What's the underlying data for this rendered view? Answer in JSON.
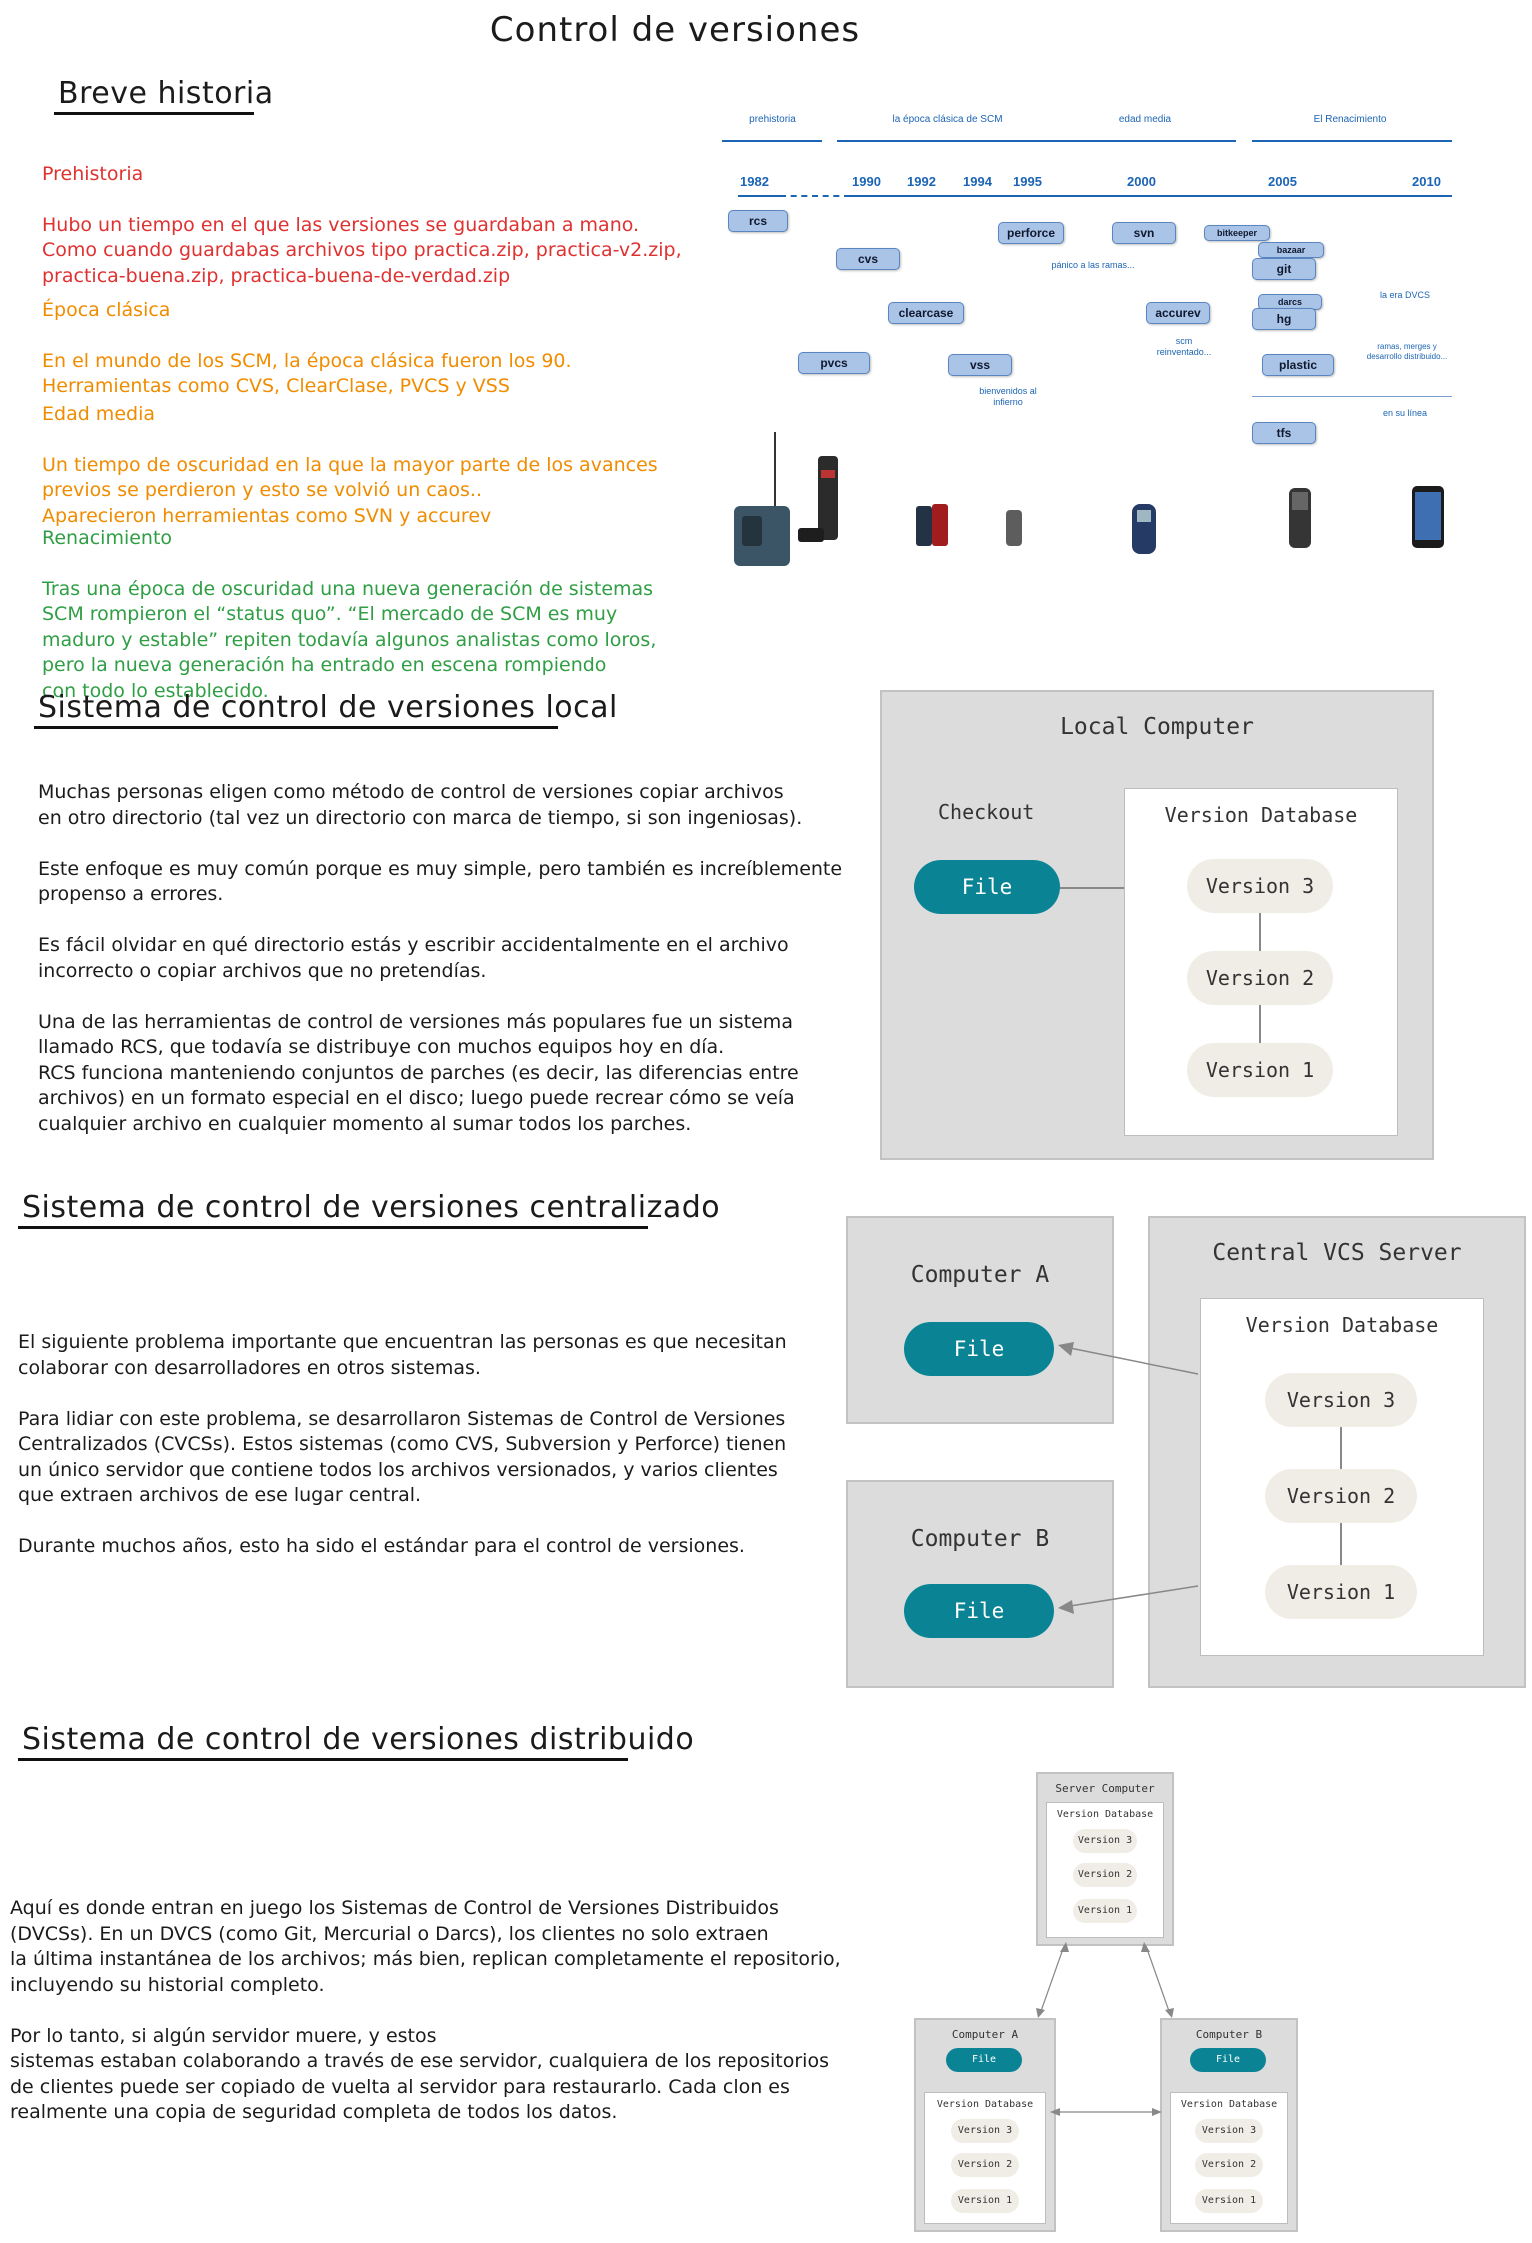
{
  "page_title": "Control de versiones",
  "history": {
    "heading": "Breve historia",
    "prehistoria": {
      "title": "Prehistoria",
      "text": "Hubo un tiempo en el que las versiones se guardaban a mano.\nComo cuando guardabas archivos tipo practica.zip, practica-v2.zip,\npractica-buena.zip, practica-buena-de-verdad.zip"
    },
    "clasica": {
      "title": "Época clásica",
      "text": "En el mundo de los SCM, la época clásica fueron los 90.\nHerramientas como CVS, ClearClase, PVCS y VSS"
    },
    "media": {
      "title": "Edad media",
      "text": "Un tiempo de oscuridad en la que la mayor parte de los avances\nprevios se perdieron y esto se volvió un caos..\nAparecieron herramientas como SVN y accurev"
    },
    "renacimiento": {
      "title": "Renacimiento",
      "text": "Tras una época de oscuridad una nueva generación de sistemas\nSCM rompieron el “status quo”. “El mercado de SCM es muy\nmaduro y estable” repiten todavía algunos analistas como loros,\npero la nueva generación ha entrado en escena rompiendo\ncon todo lo establecido."
    }
  },
  "timeline": {
    "eras": [
      "prehistoria",
      "la época clásica de SCM",
      "edad media",
      "El Renacimiento"
    ],
    "years": [
      "1982",
      "1990",
      "1992",
      "1994",
      "1995",
      "2000",
      "2005",
      "2010"
    ],
    "tools": [
      "rcs",
      "cvs",
      "clearcase",
      "pvcs",
      "vss",
      "perforce",
      "svn",
      "accurev",
      "bitkeeper",
      "bazaar",
      "git",
      "darcs",
      "hg",
      "plastic",
      "tfs"
    ],
    "notes": {
      "panico": "pánico a las ramas...",
      "bienvenidos": "bienvenidos al\ninfierno",
      "scm": "scm\nreinventado...",
      "dvcs": "la era DVCS",
      "ramas": "ramas, merges y\ndesarrollo distribuido...",
      "linea": "en su línea"
    }
  },
  "local": {
    "heading": "Sistema de control de versiones local",
    "text": "Muchas personas eligen como método de control de versiones copiar archivos\nen otro directorio (tal vez un directorio con marca de tiempo, si son ingeniosas).\n\nEste enfoque es muy común porque es muy simple, pero también es increíblemente\npropenso a errores.\n\nEs fácil olvidar en qué directorio estás y escribir accidentalmente en el archivo\nincorrecto o copiar archivos que no pretendías.\n\nUna de las herramientas de control de versiones más populares fue un sistema\nllamado RCS, que todavía se distribuye con muchos equipos hoy en día.\nRCS funciona manteniendo conjuntos de parches (es decir, las diferencias entre\narchivos) en un formato especial en el disco; luego puede recrear cómo se veía\ncualquier archivo en cualquier momento al sumar todos los parches.",
    "diagram": {
      "title": "Local Computer",
      "checkout": "Checkout",
      "file": "File",
      "db": "Version Database",
      "versions": [
        "Version 3",
        "Version 2",
        "Version 1"
      ]
    }
  },
  "central": {
    "heading": "Sistema de control de versiones centralizado",
    "text": "El siguiente problema importante que encuentran las personas es que necesitan\ncolaborar con desarrolladores en otros sistemas.\n\nPara lidiar con este problema, se desarrollaron Sistemas de Control de Versiones\nCentralizados (CVCSs). Estos sistemas (como CVS, Subversion y Perforce) tienen\nun único servidor que contiene todos los archivos versionados, y varios clientes\nque extraen archivos de ese lugar central.\n\nDurante muchos años, esto ha sido el estándar para el control de versiones.",
    "diagram": {
      "computer_a": "Computer A",
      "computer_b": "Computer B",
      "file": "File",
      "server": "Central VCS Server",
      "db": "Version Database",
      "versions": [
        "Version 3",
        "Version 2",
        "Version 1"
      ]
    }
  },
  "distributed": {
    "heading": "Sistema de control de versiones distribuido",
    "text": "Aquí es donde entran en juego los Sistemas de Control de Versiones Distribuidos\n(DVCSs). En un DVCS (como Git, Mercurial o Darcs), los clientes no solo extraen\nla última instantánea de los archivos; más bien, replican completamente el repositorio,\nincluyendo su historial completo.\n\nPor lo tanto, si algún servidor muere, y estos\nsistemas estaban colaborando a través de ese servidor, cualquiera de los repositorios\nde clientes puede ser copiado de vuelta al servidor para restaurarlo. Cada clon es\nrealmente una copia de seguridad completa de todos los datos.",
    "diagram": {
      "server": "Server Computer",
      "computer_a": "Computer A",
      "computer_b": "Computer B",
      "file": "File",
      "db": "Version Database",
      "versions": [
        "Version 3",
        "Version 2",
        "Version 1"
      ]
    }
  },
  "colors": {
    "teal": "#0a8494",
    "version_pill": "#efede6",
    "red": "#e03131",
    "orange": "#f08c00",
    "green": "#2f9e44",
    "timeline_blue": "#1c64b4"
  }
}
